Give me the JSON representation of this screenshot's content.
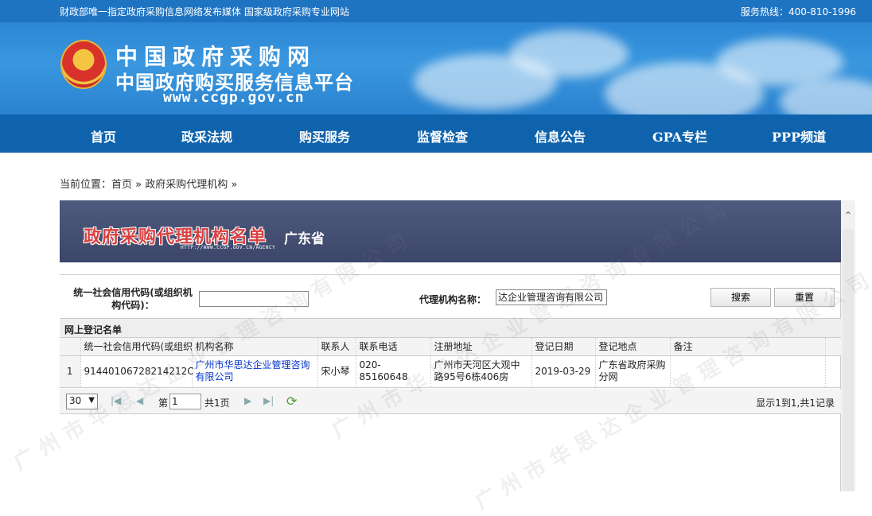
{
  "topbar": {
    "left_text": "财政部唯一指定政府采购信息网络发布媒体 国家级政府采购专业网站",
    "right_text": "服务热线：400-810-1996"
  },
  "banner": {
    "logo_line1": "中国政府采购网",
    "logo_line2": "中国政府购买服务信息平台",
    "logo_url": "www.ccgp.gov.cn"
  },
  "nav": {
    "items": [
      "首页",
      "政采法规",
      "购买服务",
      "监督检查",
      "信息公告",
      "GPA专栏",
      "PPP频道"
    ]
  },
  "breadcrumb": {
    "prefix": "当前位置：",
    "home": "首页",
    "sep": "»",
    "current": "政府采购代理机构",
    "trail": "»"
  },
  "panel_header": {
    "title": "政府采购代理机构名单",
    "province": "广东省",
    "url": "HTTP://WWW.CCGP.GOV.CN/AGENCY"
  },
  "search": {
    "credit_code_label": "统一社会信用代码(或组织机构代码)：",
    "credit_code_value": "",
    "agency_name_label": "代理机构名称：",
    "agency_name_value": "达企业管理咨询有限公司",
    "search_button": "搜索",
    "reset_button": "重置"
  },
  "list": {
    "title": "网上登记名单",
    "columns": [
      "统一社会信用代码(或组织",
      "机构名称",
      "联系人",
      "联系电话",
      "注册地址",
      "登记日期",
      "登记地点",
      "备注"
    ],
    "rows": [
      {
        "index": "1",
        "credit_code": "91440106728214212C",
        "name": "广州市华思达企业管理咨询有限公司",
        "contact": "宋小琴",
        "phone": "020-85160648",
        "address": "广州市天河区大观中路95号6栋406房",
        "date": "2019-03-29",
        "place": "广东省政府采购分网",
        "remark": ""
      }
    ]
  },
  "pager": {
    "page_size": "30",
    "page_label": "第",
    "page_value": "1",
    "total_pages": "共1页",
    "info": "显示1到1,共1记录"
  },
  "watermark": "广州市华思达企业管理咨询有限公司",
  "colors": {
    "nav_bg": "#0f63ad",
    "topbar_bg": "#1f74c2",
    "header_band": "#4e5a7e",
    "title_red": "#d94141",
    "link_blue": "#0033cc"
  }
}
